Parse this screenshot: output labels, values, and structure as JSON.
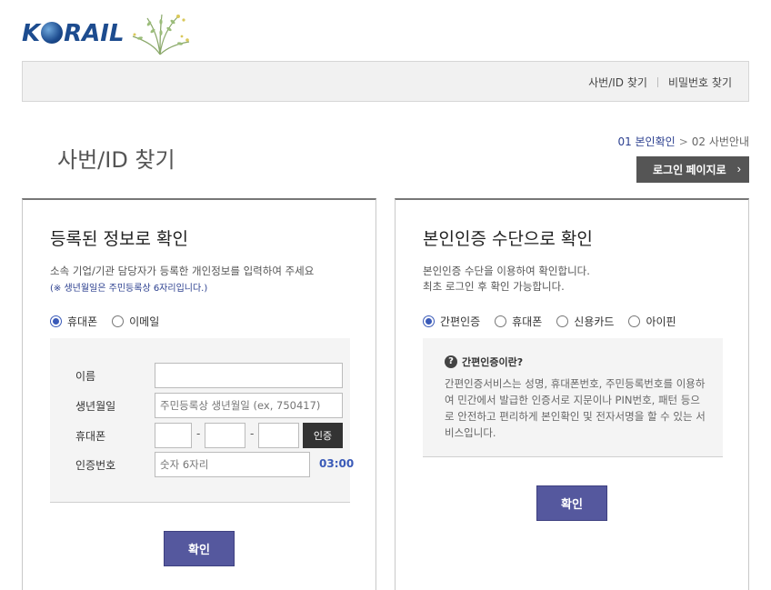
{
  "brand": {
    "logo_text_pre": "K",
    "logo_text_post": "RAIL"
  },
  "topnav": {
    "item1": "사번/ID 찾기",
    "item2": "비밀번호 찾기"
  },
  "page": {
    "title": "사번/ID 찾기"
  },
  "steps": {
    "step1": "01 본인확인",
    "arrow": ">",
    "step2": "02 사번안내"
  },
  "login_button": {
    "label": "로그인 페이지로",
    "chevron": "›"
  },
  "left_panel": {
    "title": "등록된 정보로 확인",
    "desc": "소속 기업/기관 담당자가 등록한 개인정보를 입력하여 주세요",
    "note": "(※ 생년월일은 주민등록상 6자리입니다.)",
    "radios": [
      {
        "label": "휴대폰",
        "checked": true
      },
      {
        "label": "이메일",
        "checked": false
      }
    ],
    "form": {
      "name_label": "이름",
      "birth_label": "생년월일",
      "birth_placeholder": "주민등록상 생년월일 (ex, 750417)",
      "phone_label": "휴대폰",
      "phone_dash": "-",
      "auth_button": "인증",
      "code_label": "인증번호",
      "code_placeholder": "숫자 6자리",
      "timer": "03:00"
    },
    "confirm": "확인"
  },
  "right_panel": {
    "title": "본인인증 수단으로 확인",
    "desc_line1": "본인인증 수단을 이용하여 확인합니다.",
    "desc_line2": "최초 로그인 후 확인 가능합니다.",
    "radios": [
      {
        "label": "간편인증",
        "checked": true
      },
      {
        "label": "휴대폰",
        "checked": false
      },
      {
        "label": "신용카드",
        "checked": false
      },
      {
        "label": "아이핀",
        "checked": false
      }
    ],
    "info_title": "간편인증이란?",
    "info_icon": "?",
    "info_body": "간편인증서비스는 성명, 휴대폰번호, 주민등록번호를 이용하여 민간에서 발급한 인증서로 지문이나 PIN번호, 패턴 등으로 안전하고 편리하게 본인확인 및 전자서명을 할 수 있는 서비스입니다.",
    "confirm": "확인"
  },
  "colors": {
    "brand_blue": "#1d4c8f",
    "accent": "#3a5ab8",
    "button": "#55589e"
  },
  "icons": {
    "logo": "korail-logo",
    "plant": "plant-decoration-icon",
    "info": "question-circle-icon",
    "chevron": "chevron-right-icon"
  }
}
